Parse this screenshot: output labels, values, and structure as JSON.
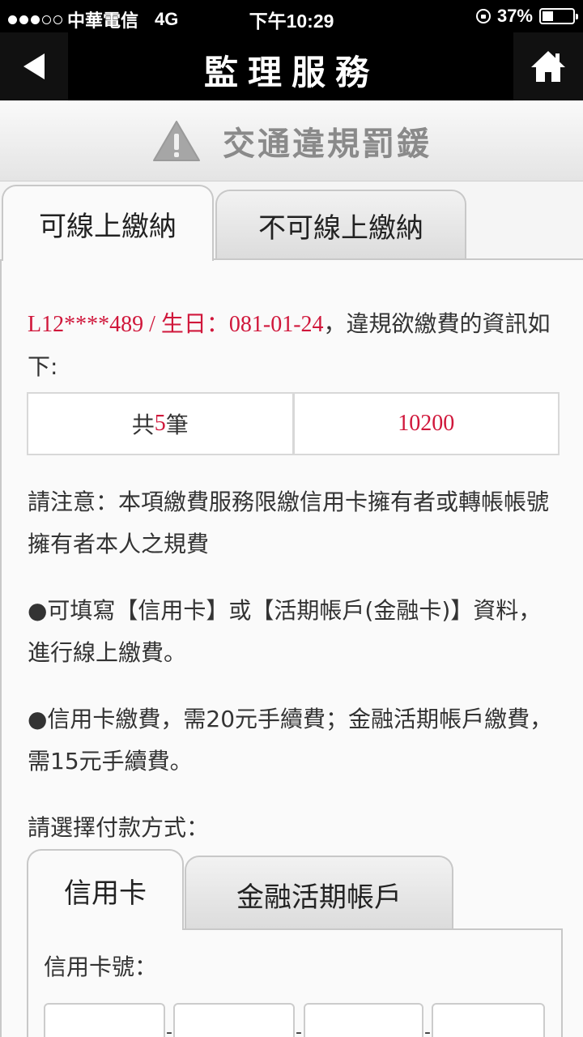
{
  "status_bar": {
    "carrier": "中華電信",
    "network": "4G",
    "time": "下午10:29",
    "battery_percent": "37%",
    "battery_level": 0.37
  },
  "nav": {
    "title": "監理服務",
    "back_icon": "back-arrow-icon",
    "home_icon": "home-icon"
  },
  "section": {
    "title": "交通違規罰鍰",
    "icon": "warning-icon"
  },
  "tabs": [
    {
      "label": "可線上繳納",
      "active": true
    },
    {
      "label": "不可線上繳納",
      "active": false
    }
  ],
  "info": {
    "id_prefix": "L12****489 / 生日：081-01-24",
    "id_suffix": "，違規欲繳費的資訊如下:"
  },
  "summary": {
    "count_prefix": "共",
    "count": "5",
    "count_suffix": "筆",
    "amount": "10200"
  },
  "notes": {
    "notice": "請注意：本項繳費服務限繳信用卡擁有者或轉帳帳號擁有者本人之規費",
    "bullet1": "●可填寫【信用卡】或【活期帳戶(金融卡)】資料，進行線上繳費。",
    "bullet2": "●信用卡繳費，需20元手續費；金融活期帳戶繳費，需15元手續費。"
  },
  "payment": {
    "prompt": "請選擇付款方式：",
    "tabs": [
      {
        "label": "信用卡",
        "active": true
      },
      {
        "label": "金融活期帳戶",
        "active": false
      }
    ],
    "card_number_label": "信用卡號：",
    "separators": [
      "-",
      "-",
      "-"
    ]
  },
  "colors": {
    "accent_red": "#d0173b",
    "nav_bg": "#000000"
  }
}
